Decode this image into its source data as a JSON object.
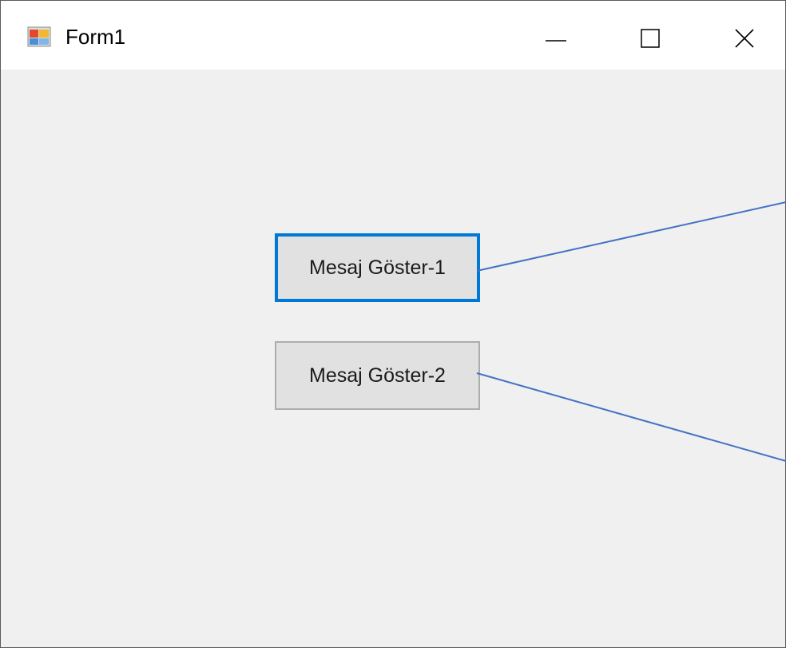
{
  "window": {
    "title": "Form1",
    "icon": "winforms-app-icon",
    "controls": {
      "minimize": "minimize-icon",
      "maximize": "maximize-icon",
      "close": "close-icon"
    }
  },
  "form": {
    "buttons": [
      {
        "label": "Mesaj Göster-1",
        "focused": true
      },
      {
        "label": "Mesaj Göster-2",
        "focused": false
      }
    ]
  },
  "colors": {
    "client_background": "#f0f0f0",
    "button_face": "#e1e1e1",
    "focus_border": "#0078d7",
    "callout_line": "#4472c4"
  }
}
